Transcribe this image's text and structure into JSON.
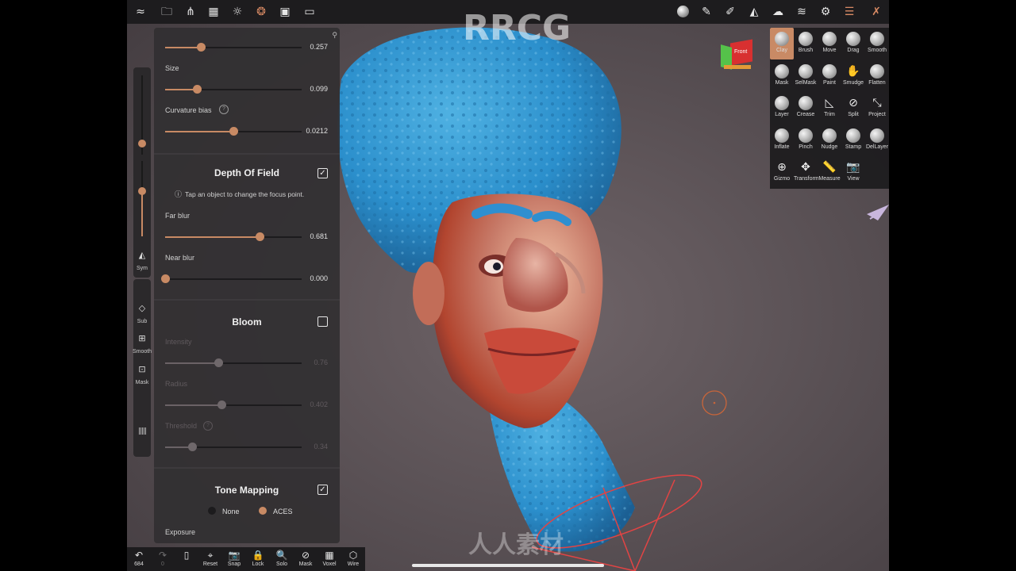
{
  "watermark": {
    "brand": "RRCG",
    "cn": "人人素材"
  },
  "topbar": {
    "left_icons": [
      "logo-icon",
      "folder-icon",
      "scene-icon",
      "grid-icon",
      "sun-icon",
      "material-icon",
      "image-icon",
      "video-icon"
    ],
    "right_icons": [
      "matcap-icon",
      "pen-icon",
      "stroke-icon",
      "symmetry-icon",
      "cloud-icon",
      "layers-icon",
      "settings-icon",
      "sliders-icon",
      "tools-icon"
    ]
  },
  "orientation_cube": {
    "label": "Front"
  },
  "strip": {
    "sym": "Sym",
    "sub": "Sub",
    "smooth": "Smooth",
    "mask": "Mask"
  },
  "panel": {
    "top_slider": {
      "value": "0.257",
      "fraction": 0.26
    },
    "size": {
      "label": "Size",
      "value": "0.099",
      "fraction": 0.23
    },
    "curvature": {
      "label": "Curvature bias",
      "value": "0.0212",
      "fraction": 0.5
    },
    "dof": {
      "title": "Depth Of Field",
      "checked": true,
      "hint": "Tap an object to change the focus point.",
      "far_blur": {
        "label": "Far blur",
        "value": "0.681",
        "fraction": 0.69
      },
      "near_blur": {
        "label": "Near blur",
        "value": "0.000",
        "fraction": 0.0
      }
    },
    "bloom": {
      "title": "Bloom",
      "checked": false,
      "intensity": {
        "label": "Intensity",
        "value": "0.76",
        "fraction": 0.39
      },
      "radius": {
        "label": "Radius",
        "value": "0.402",
        "fraction": 0.41
      },
      "threshold": {
        "label": "Threshold",
        "value": "0.34",
        "fraction": 0.2
      }
    },
    "tone": {
      "title": "Tone Mapping",
      "checked": true,
      "option_none": "None",
      "option_aces": "ACES",
      "exposure_label": "Exposure"
    }
  },
  "palette": {
    "rows": [
      [
        {
          "name": "Clay",
          "style": "ball",
          "active": true
        },
        {
          "name": "Brush",
          "style": "ball"
        },
        {
          "name": "Move",
          "style": "ball"
        },
        {
          "name": "Drag",
          "style": "ball"
        },
        {
          "name": "Smooth",
          "style": "ball"
        }
      ],
      [
        {
          "name": "Mask",
          "style": "ball"
        },
        {
          "name": "SelMask",
          "style": "ball"
        },
        {
          "name": "Paint",
          "style": "ball"
        },
        {
          "name": "Smudge",
          "style": "glyph",
          "glyph": "✋"
        },
        {
          "name": "Flatten",
          "style": "ball"
        }
      ],
      [
        {
          "name": "Layer",
          "style": "ball"
        },
        {
          "name": "Crease",
          "style": "ball"
        },
        {
          "name": "Trim",
          "style": "glyph",
          "glyph": "◺"
        },
        {
          "name": "Split",
          "style": "glyph",
          "glyph": "⊘"
        },
        {
          "name": "Project",
          "style": "glyph",
          "glyph": "⤡"
        }
      ],
      [
        {
          "name": "Inflate",
          "style": "ball"
        },
        {
          "name": "Pinch",
          "style": "ball"
        },
        {
          "name": "Nudge",
          "style": "ball"
        },
        {
          "name": "Stamp",
          "style": "ball"
        },
        {
          "name": "DelLayer",
          "style": "ball"
        }
      ],
      [
        {
          "name": "Gizmo",
          "style": "glyph",
          "glyph": "⊕"
        },
        {
          "name": "Transform",
          "style": "glyph",
          "glyph": "✥"
        },
        {
          "name": "Measure",
          "style": "glyph",
          "glyph": "📏"
        },
        {
          "name": "View",
          "style": "glyph",
          "glyph": "📷"
        }
      ]
    ]
  },
  "bottombar": {
    "undo": {
      "glyph": "↶",
      "label": "684"
    },
    "redo": {
      "glyph": "↷",
      "label": "0"
    },
    "buttons": [
      {
        "name": "reset",
        "glyph": "⌖",
        "label": "Reset"
      },
      {
        "name": "snap",
        "glyph": "📷",
        "label": "Snap"
      },
      {
        "name": "lock",
        "glyph": "🔒",
        "label": "Lock"
      },
      {
        "name": "solo",
        "glyph": "🔍",
        "label": "Solo"
      },
      {
        "name": "mask",
        "glyph": "⊘",
        "label": "Mask"
      },
      {
        "name": "voxel",
        "glyph": "▦",
        "label": "Voxel"
      },
      {
        "name": "wire",
        "glyph": "⬡",
        "label": "Wire"
      }
    ]
  }
}
